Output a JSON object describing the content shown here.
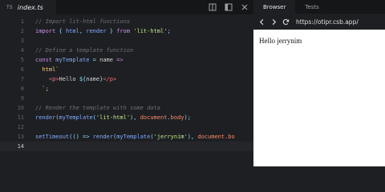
{
  "editor": {
    "tab": {
      "lang": "TS",
      "filename": "index.ts"
    },
    "icons": [
      "split-icon",
      "layout-icon",
      "close-icon"
    ],
    "lines": [
      {
        "n": "1",
        "tokens": [
          {
            "t": "// Import lit-html functions",
            "c": "c-com"
          }
        ]
      },
      {
        "n": "2",
        "tokens": [
          {
            "t": "import",
            "c": "c-kw"
          },
          {
            "t": " { ",
            "c": "c-pun"
          },
          {
            "t": "html",
            "c": "c-var"
          },
          {
            "t": ", ",
            "c": "c-pun"
          },
          {
            "t": "render",
            "c": "c-var"
          },
          {
            "t": " } ",
            "c": "c-pun"
          },
          {
            "t": "from",
            "c": "c-kw"
          },
          {
            "t": " ",
            "c": "c-pl"
          },
          {
            "t": "'lit-html'",
            "c": "c-str"
          },
          {
            "t": ";",
            "c": "c-pun"
          }
        ]
      },
      {
        "n": "3",
        "tokens": []
      },
      {
        "n": "4",
        "tokens": [
          {
            "t": "// Define a template function",
            "c": "c-com"
          }
        ]
      },
      {
        "n": "5",
        "tokens": [
          {
            "t": "const",
            "c": "c-kw"
          },
          {
            "t": " ",
            "c": "c-pl"
          },
          {
            "t": "myTemplate",
            "c": "c-var"
          },
          {
            "t": " = ",
            "c": "c-pun"
          },
          {
            "t": "name",
            "c": "c-pl"
          },
          {
            "t": " =>",
            "c": "c-kw"
          }
        ]
      },
      {
        "n": "6",
        "tokens": [
          {
            "t": "  ",
            "c": "c-pl"
          },
          {
            "t": "html",
            "c": "c-fn"
          },
          {
            "t": "`",
            "c": "c-str"
          }
        ]
      },
      {
        "n": "7",
        "tokens": [
          {
            "t": "    ",
            "c": "c-pl"
          },
          {
            "t": "<p>",
            "c": "c-tag"
          },
          {
            "t": "Hello ",
            "c": "c-pl"
          },
          {
            "t": "${",
            "c": "c-pun"
          },
          {
            "t": "name",
            "c": "c-pl"
          },
          {
            "t": "}",
            "c": "c-pun"
          },
          {
            "t": "</p>",
            "c": "c-tag"
          }
        ]
      },
      {
        "n": "8",
        "tokens": [
          {
            "t": "  `;",
            "c": "c-str"
          }
        ]
      },
      {
        "n": "9",
        "tokens": []
      },
      {
        "n": "10",
        "tokens": [
          {
            "t": "// Render the template with some data",
            "c": "c-com"
          }
        ]
      },
      {
        "n": "11",
        "tokens": [
          {
            "t": "render",
            "c": "c-var"
          },
          {
            "t": "(",
            "c": "c-pun"
          },
          {
            "t": "myTemplate",
            "c": "c-var"
          },
          {
            "t": "(",
            "c": "c-pun"
          },
          {
            "t": "'lit-html'",
            "c": "c-str"
          },
          {
            "t": "), ",
            "c": "c-pun"
          },
          {
            "t": "document",
            "c": "c-prop"
          },
          {
            "t": ".",
            "c": "c-pun"
          },
          {
            "t": "body",
            "c": "c-prop"
          },
          {
            "t": ");",
            "c": "c-pun"
          }
        ]
      },
      {
        "n": "12",
        "tokens": []
      },
      {
        "n": "13",
        "tokens": [
          {
            "t": "setTimeout",
            "c": "c-var"
          },
          {
            "t": "(() => ",
            "c": "c-pun"
          },
          {
            "t": "render",
            "c": "c-var"
          },
          {
            "t": "(",
            "c": "c-pun"
          },
          {
            "t": "myTemplate",
            "c": "c-var"
          },
          {
            "t": "(",
            "c": "c-pun"
          },
          {
            "t": "'jerrynim'",
            "c": "c-str"
          },
          {
            "t": "), ",
            "c": "c-pun"
          },
          {
            "t": "document",
            "c": "c-prop"
          },
          {
            "t": ".bo",
            "c": "c-prop"
          }
        ]
      },
      {
        "n": "14",
        "tokens": []
      }
    ],
    "current_line": "14"
  },
  "preview": {
    "tabs": [
      {
        "label": "Browser",
        "active": true
      },
      {
        "label": "Tests",
        "active": false
      }
    ],
    "nav_icons": [
      "back-arrow-icon",
      "forward-arrow-icon",
      "refresh-icon"
    ],
    "url": "https://otipr.csb.app/",
    "page_text": "Hello jerrynim"
  },
  "colors": {
    "editor_bg": "#1e1f22",
    "tabbar_bg": "#151618",
    "comment": "#6a6f77",
    "keyword": "#c792ea",
    "string": "#c3e88d",
    "tag": "#f07178"
  }
}
